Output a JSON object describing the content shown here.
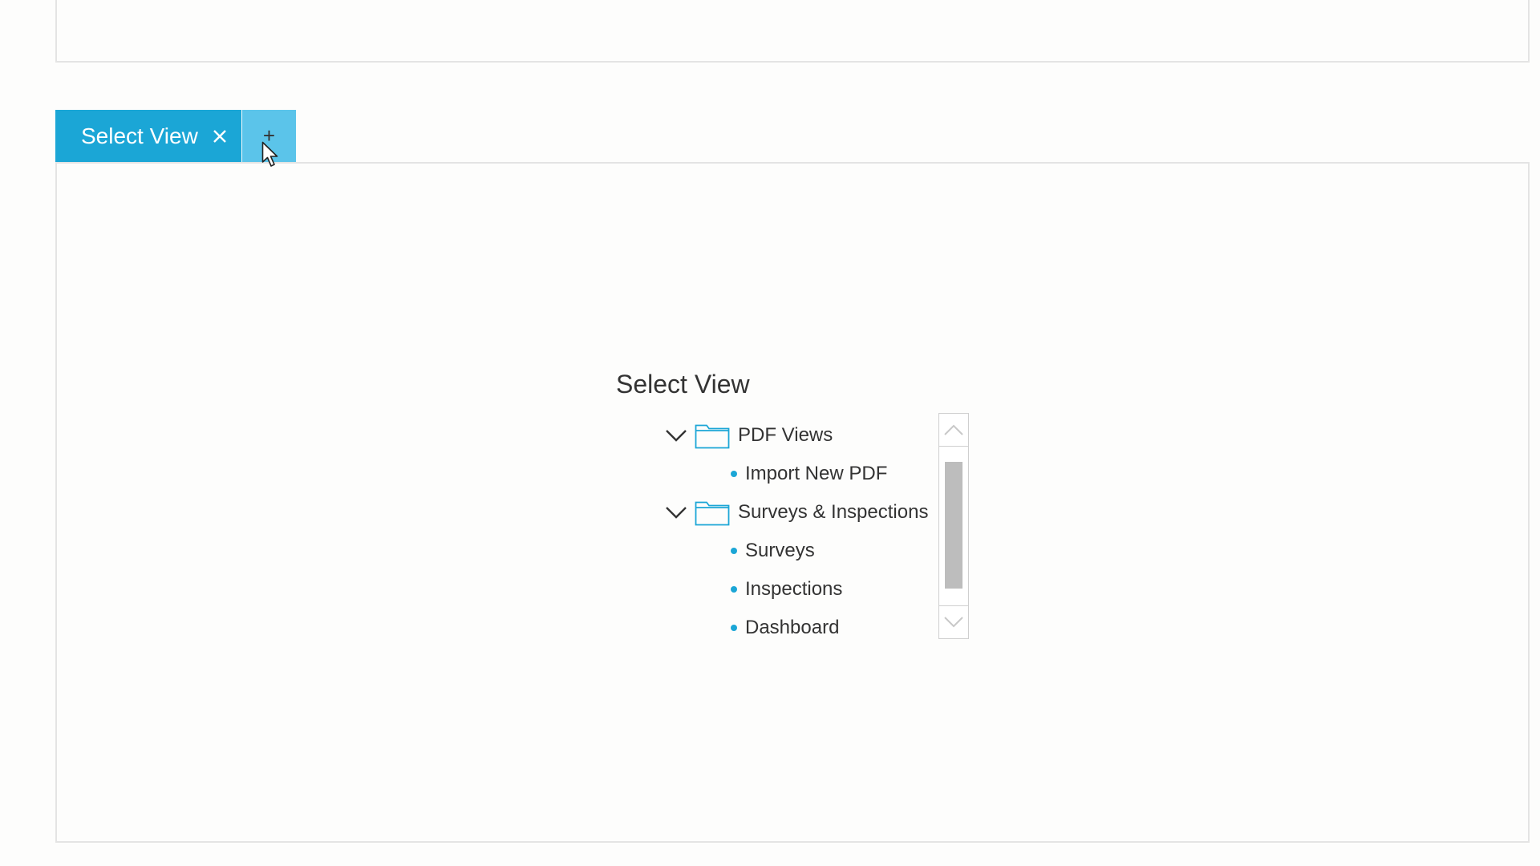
{
  "tabs": {
    "active_label": "Select View",
    "close_icon": "close-icon",
    "add_label": "+"
  },
  "selector": {
    "title": "Select View",
    "tree": [
      {
        "label": "PDF Views",
        "expanded": true,
        "icon": "folder-icon",
        "children": [
          "Import New PDF"
        ]
      },
      {
        "label": "Surveys & Inspections",
        "expanded": true,
        "icon": "folder-icon",
        "children": [
          "Surveys",
          "Inspections",
          "Dashboard"
        ]
      }
    ]
  },
  "colors": {
    "accent": "#1ba6d6",
    "accent_light": "#5bc4ea",
    "panel_border": "#e4e4e4",
    "scroll_thumb": "#bdbdbd"
  }
}
